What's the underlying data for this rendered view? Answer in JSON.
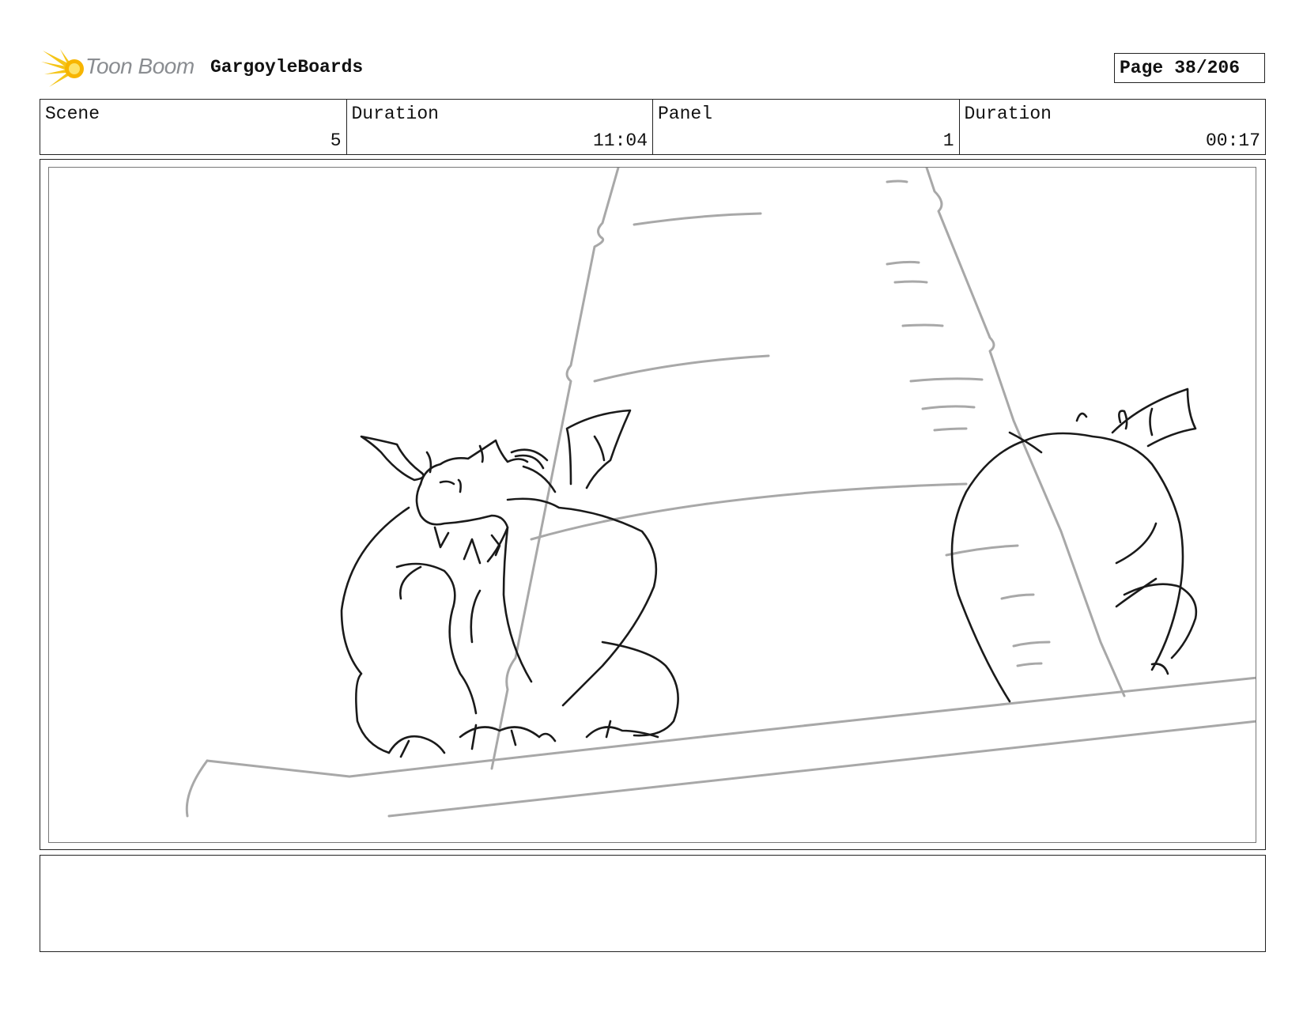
{
  "header": {
    "logo_text": "Toon Boom",
    "project_title": "GargoyleBoards",
    "page_label": "Page",
    "page_value": "38/206"
  },
  "info": [
    {
      "label": "Scene",
      "value": "5"
    },
    {
      "label": "Duration",
      "value": "11:04"
    },
    {
      "label": "Panel",
      "value": "1"
    },
    {
      "label": "Duration",
      "value": "00:17"
    }
  ],
  "notes": {
    "text": ""
  },
  "colors": {
    "logo_yellow": "#f5c518",
    "logo_orange": "#f39c12",
    "sketch_black": "#1a1a1a",
    "sketch_gray": "#a8a8a8"
  }
}
